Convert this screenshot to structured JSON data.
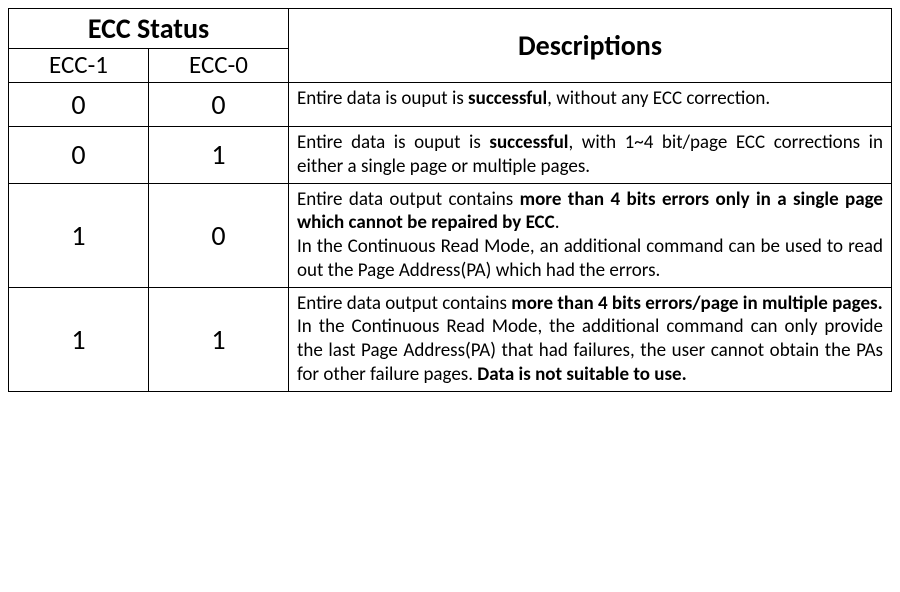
{
  "headers": {
    "group": "ECC Status",
    "col_ecc1": "ECC-1",
    "col_ecc0": "ECC-0",
    "desc": "Descriptions"
  },
  "rows": [
    {
      "ecc1": "0",
      "ecc0": "0",
      "segments": [
        {
          "t": "Entire data is ouput is ",
          "b": false
        },
        {
          "t": "successful",
          "b": true
        },
        {
          "t": ", without any ECC correction.",
          "b": false
        }
      ]
    },
    {
      "ecc1": "0",
      "ecc0": "1",
      "segments": [
        {
          "t": "Entire data is ouput is ",
          "b": false
        },
        {
          "t": "successful",
          "b": true
        },
        {
          "t": ", with 1~4 bit/page ECC corrections in either a single page or multiple pages.",
          "b": false
        }
      ]
    },
    {
      "ecc1": "1",
      "ecc0": "0",
      "segments": [
        {
          "t": "Entire data output contains ",
          "b": false
        },
        {
          "t": "more than 4 bits errors only in a single page which cannot be repaired by ECC",
          "b": true
        },
        {
          "t": ".",
          "b": false
        },
        {
          "br": true
        },
        {
          "t": "In the Continuous Read Mode, an additional command can be used to read out the Page Address(PA) which had the errors.",
          "b": false
        }
      ]
    },
    {
      "ecc1": "1",
      "ecc0": "1",
      "segments": [
        {
          "t": "Entire data output contains ",
          "b": false
        },
        {
          "t": "more than 4 bits errors/page in multiple pages.",
          "b": true
        },
        {
          "br": true
        },
        {
          "t": "In the Continuous Read Mode, the additional command can only provide the last Page Address(PA) that had failures, the user cannot obtain the PAs for other failure pages. ",
          "b": false
        },
        {
          "t": "Data is not suitable to use.",
          "b": true
        }
      ]
    }
  ]
}
